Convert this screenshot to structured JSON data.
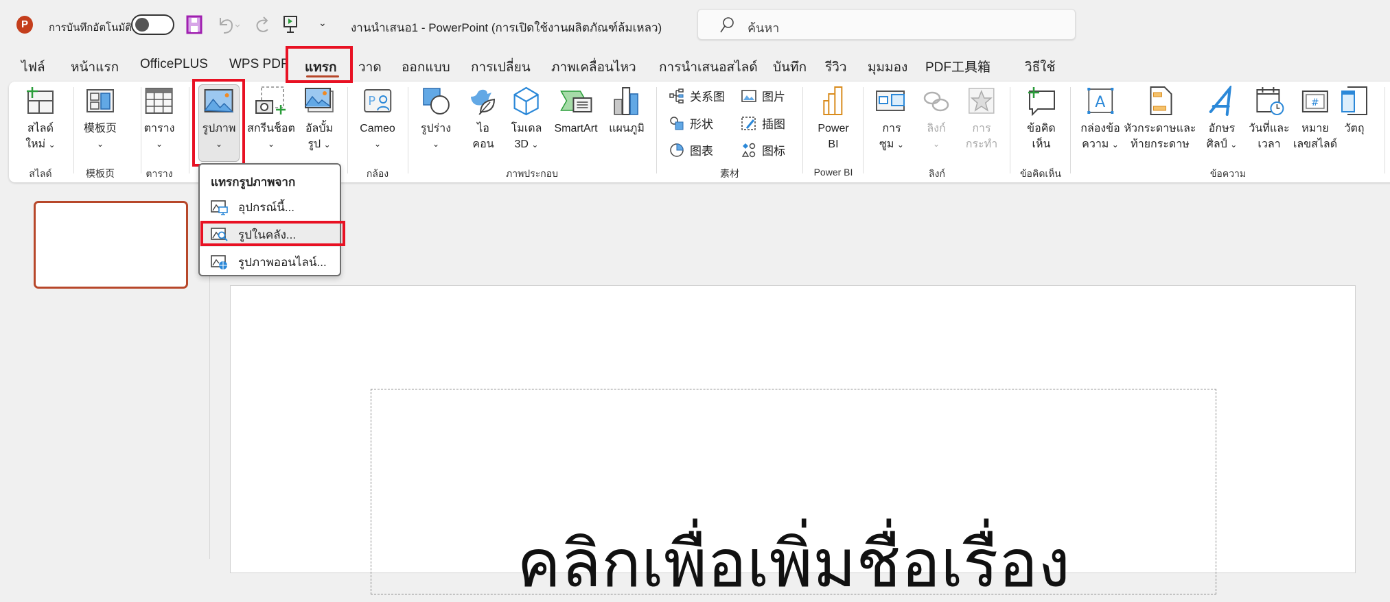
{
  "titlebar": {
    "autosave_label": "การบันทึกอัตโนมัติ",
    "title": "งานนำเสนอ1  -  PowerPoint (การเปิดใช้งานผลิตภัณฑ์ล้มเหลว)",
    "search_placeholder": "ค้นหา"
  },
  "tabs": [
    "ไฟล์",
    "หน้าแรก",
    "OfficePLUS",
    "WPS PDF",
    "แทรก",
    "วาด",
    "ออกแบบ",
    "การเปลี่ยน",
    "ภาพเคลื่อนไหว",
    "การนำเสนอสไลด์",
    "บันทึก",
    "รีวิว",
    "มุมมอง",
    "PDF工具箱",
    "วิธีใช้"
  ],
  "active_tab": "แทรก",
  "ribbon": {
    "buttons": {
      "new_slide_1": "สไลด์",
      "new_slide_2": "ใหม่",
      "template": "模板页",
      "table": "ตาราง",
      "picture": "รูปภาพ",
      "screenshot": "สกรีนช็อต",
      "album_1": "อัลบั้ม",
      "album_2": "รูป",
      "cameo": "Cameo",
      "shapes": "รูปร่าง",
      "icons_1": "ไอ",
      "icons_2": "คอน",
      "model3d_1": "โมเดล",
      "model3d_2": "3D",
      "smartart": "SmartArt",
      "chart": "แผนภูมิ",
      "powerbi_1": "Power",
      "powerbi_2": "BI",
      "zoom_1": "การ",
      "zoom_2": "ซูม",
      "link": "ลิงก์",
      "action_1": "การ",
      "action_2": "กระทำ",
      "comment_1": "ข้อคิด",
      "comment_2": "เห็น",
      "textbox_1": "กล่องข้อ",
      "textbox_2": "ความ",
      "header_1": "หัวกระดาษและ",
      "header_2": "ท้ายกระดาษ",
      "wordart_1": "อักษร",
      "wordart_2": "ศิลป์",
      "datetime_1": "วันที่และ",
      "datetime_2": "เวลา",
      "slidenum_1": "หมาย",
      "slidenum_2": "เลขสไลด์",
      "object": "วัตถุ"
    },
    "assets": [
      "关系图",
      "图片",
      "形状",
      "插图",
      "图表",
      "图标"
    ],
    "groups": {
      "slides": "สไลด์",
      "template": "模板页",
      "table": "ตาราง",
      "camera": "กล้อง",
      "illustrations": "ภาพประกอบ",
      "assets": "素材",
      "powerbi": "Power BI",
      "links": "ลิงก์",
      "comments": "ข้อคิดเห็น",
      "text": "ข้อความ"
    }
  },
  "picture_menu": {
    "header": "แทรกรูปภาพจาก",
    "items": [
      "อุปกรณ์นี้...",
      "รูปในคลัง...",
      "รูปภาพออนไลน์..."
    ],
    "highlighted_index": 1
  },
  "slide": {
    "title_placeholder": "คลิกเพื่อเพิ่มชื่อเรื่อง"
  },
  "colors": {
    "accent": "#b7472a",
    "highlight": "#e81123",
    "icon_blue": "#2b88d8"
  }
}
